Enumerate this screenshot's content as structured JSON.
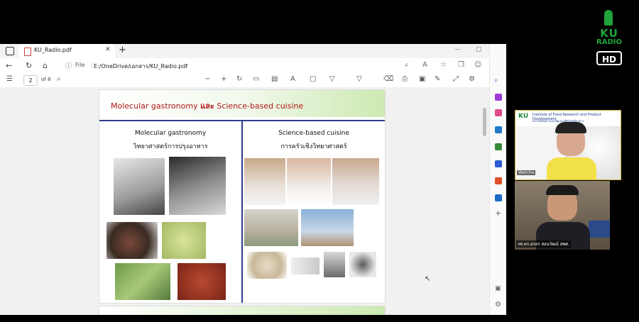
{
  "browser": {
    "tab_title": "KU_Radio.pdf",
    "tab_close": "✕",
    "new_tab": "+",
    "address_scheme": "File",
    "address_separator": "|",
    "address_url": "E:/OneDrive/เอกสาร/KU_Radio.pdf",
    "window_minimize": "—",
    "window_maximize": "□",
    "window_close": "✕",
    "more_menu": "···"
  },
  "pdf_toolbar": {
    "current_page": "2",
    "page_of": "of 8"
  },
  "slide": {
    "title_left": "Molecular gastronomy",
    "title_and": "และ",
    "title_right": "Science-based cuisine",
    "left_heading_en": "Molecular gastronomy",
    "left_heading_th": "วิทยาศาสตร์การปรุงอาหาร",
    "right_heading_en": "Science-based cuisine",
    "right_heading_th": "การครัวเชิงวิทยาศาสตร์"
  },
  "logo": {
    "ku": "KU",
    "radio": "RADIO",
    "hd": "HD"
  },
  "video": {
    "tile1_ku": "KU",
    "tile1_institute": "Institute of Food Research and Product Development",
    "tile1_institute_th": "สถาบันค้นคว้าและพัฒนาผลิตภัณฑ์อาหาร",
    "tile1_name": "Watcha",
    "tile2_name": "รศ.ดร.อรอร สอนวัฒน์ สพศ."
  },
  "colors": {
    "title_red": "#b01818",
    "rule_blue": "#2e3c8a",
    "ku_green": "#1fa33a",
    "slide_green": "#cde9b2"
  }
}
